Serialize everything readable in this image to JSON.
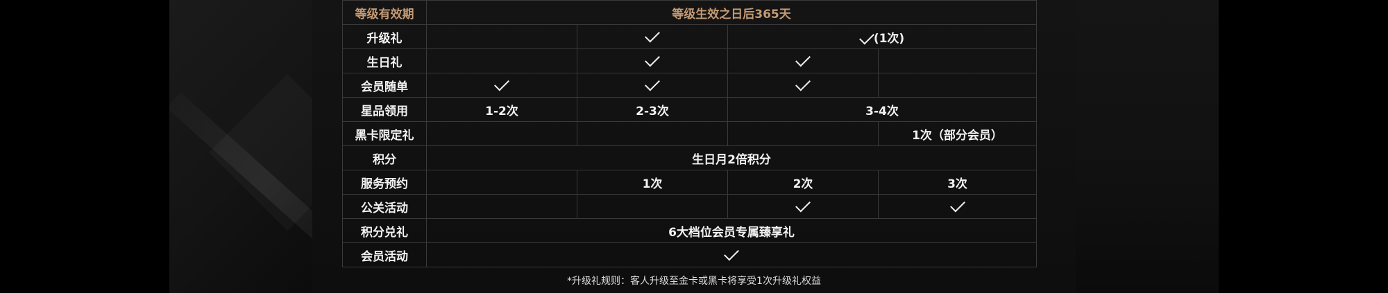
{
  "table": {
    "header": {
      "label": "等级有效期",
      "value": "等级生效之日后365天"
    },
    "rows": {
      "upgrade": {
        "label": "升级礼",
        "note": "(1次)"
      },
      "birthday": {
        "label": "生日礼"
      },
      "member_gift": {
        "label": "会员随单"
      },
      "star_product": {
        "label": "星品领用",
        "c1": "1-2次",
        "c2": "2-3次",
        "c3": "3-4次"
      },
      "black_card": {
        "label": "黑卡限定礼",
        "c4": "1次（部分会员）"
      },
      "points": {
        "label": "积分",
        "value": "生日月2倍积分"
      },
      "service": {
        "label": "服务预约",
        "c2": "1次",
        "c3": "2次",
        "c4": "3次"
      },
      "pr_event": {
        "label": "公关活动"
      },
      "redeem": {
        "label": "积分兑礼",
        "value": "6大档位会员专属臻享礼"
      },
      "member_event": {
        "label": "会员活动"
      }
    }
  },
  "footnote": "*升级礼规则：客人升级至金卡或黑卡将享受1次升级礼权益",
  "colors": {
    "header_text": "#c49a74",
    "background": "#111111",
    "border": "#3a3a3a"
  },
  "icons": {
    "check": "check-icon"
  }
}
